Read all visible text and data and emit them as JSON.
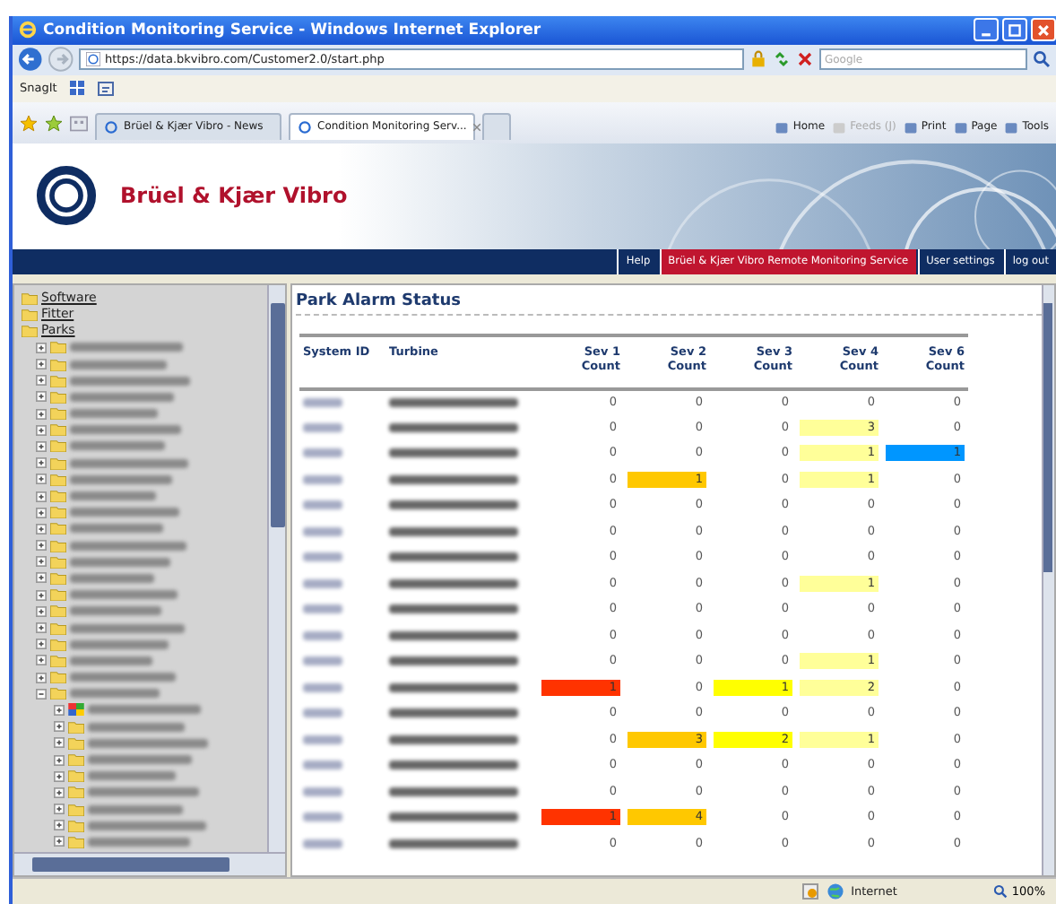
{
  "window": {
    "title": "Condition Monitoring Service - Windows Internet Explorer"
  },
  "address_bar": {
    "url": "https://data.bkvibro.com/Customer2.0/start.php"
  },
  "search": {
    "placeholder": "Google"
  },
  "links_bar": [
    {
      "label": "SnagIt"
    }
  ],
  "tabs": [
    {
      "label": "Brüel & Kjær Vibro - News",
      "selected": false
    },
    {
      "label": "Condition Monitoring Serv...",
      "selected": true
    }
  ],
  "command_bar": [
    {
      "label": "Home",
      "disabled": false
    },
    {
      "label": "Feeds (J)",
      "disabled": true
    },
    {
      "label": "Print",
      "disabled": false
    },
    {
      "label": "Page",
      "disabled": false
    },
    {
      "label": "Tools",
      "disabled": false
    }
  ],
  "header": {
    "brand": "Brüel & Kjær Vibro"
  },
  "nav": [
    {
      "label": "Help",
      "selected": false
    },
    {
      "label": "Brüel & Kjær Vibro Remote Monitoring Service",
      "selected": true
    },
    {
      "label": "User settings",
      "selected": false
    },
    {
      "label": "log out",
      "selected": false
    }
  ],
  "tree": [
    {
      "label": "Software",
      "kind": "folder"
    },
    {
      "label": "Fitter",
      "kind": "folder"
    },
    {
      "label": "Parks",
      "kind": "folder",
      "children": [
        {
          "kind": "folder"
        },
        {
          "kind": "folder"
        },
        {
          "kind": "folder"
        },
        {
          "kind": "folder"
        },
        {
          "kind": "folder"
        },
        {
          "kind": "folder"
        },
        {
          "kind": "folder"
        },
        {
          "kind": "folder"
        },
        {
          "kind": "folder"
        },
        {
          "kind": "folder"
        },
        {
          "kind": "folder"
        },
        {
          "kind": "folder"
        },
        {
          "kind": "folder"
        },
        {
          "kind": "folder"
        },
        {
          "kind": "folder"
        },
        {
          "kind": "folder"
        },
        {
          "kind": "folder"
        },
        {
          "kind": "folder"
        },
        {
          "kind": "folder"
        },
        {
          "kind": "folder"
        },
        {
          "kind": "folder"
        },
        {
          "kind": "folder",
          "children": [
            {
              "kind": "status"
            },
            {
              "kind": "folder"
            },
            {
              "kind": "folder"
            },
            {
              "kind": "folder"
            },
            {
              "kind": "folder"
            },
            {
              "kind": "folder"
            },
            {
              "kind": "folder"
            },
            {
              "kind": "folder"
            },
            {
              "kind": "folder"
            }
          ]
        }
      ]
    }
  ],
  "content": {
    "title": "Park Alarm Status",
    "columns": [
      {
        "label": "System ID"
      },
      {
        "label": "Turbine"
      },
      {
        "label": "Sev 1 Count",
        "color": "#ff3300"
      },
      {
        "label": "Sev 2 Count",
        "color": "#ffc800"
      },
      {
        "label": "Sev 3 Count",
        "color": "#ffff00"
      },
      {
        "label": "Sev 4 Count",
        "color": "#ffff99"
      },
      {
        "label": "Sev 6 Count",
        "color": "#0096ff"
      }
    ],
    "rows": [
      {
        "counts": [
          "0",
          "0",
          "0",
          "0",
          "0"
        ],
        "alerts": [
          false,
          false,
          false,
          false,
          false
        ]
      },
      {
        "counts": [
          "0",
          "0",
          "0",
          "3",
          "0"
        ],
        "alerts": [
          false,
          false,
          false,
          true,
          false
        ]
      },
      {
        "counts": [
          "0",
          "0",
          "0",
          "1",
          "1"
        ],
        "alerts": [
          false,
          false,
          false,
          true,
          true
        ]
      },
      {
        "counts": [
          "0",
          "1",
          "0",
          "1",
          "0"
        ],
        "alerts": [
          false,
          true,
          false,
          true,
          false
        ]
      },
      {
        "counts": [
          "0",
          "0",
          "0",
          "0",
          "0"
        ],
        "alerts": [
          false,
          false,
          false,
          false,
          false
        ]
      },
      {
        "counts": [
          "0",
          "0",
          "0",
          "0",
          "0"
        ],
        "alerts": [
          false,
          false,
          false,
          false,
          false
        ]
      },
      {
        "counts": [
          "0",
          "0",
          "0",
          "0",
          "0"
        ],
        "alerts": [
          false,
          false,
          false,
          false,
          false
        ]
      },
      {
        "counts": [
          "0",
          "0",
          "0",
          "1",
          "0"
        ],
        "alerts": [
          false,
          false,
          false,
          true,
          false
        ]
      },
      {
        "counts": [
          "0",
          "0",
          "0",
          "0",
          "0"
        ],
        "alerts": [
          false,
          false,
          false,
          false,
          false
        ]
      },
      {
        "counts": [
          "0",
          "0",
          "0",
          "0",
          "0"
        ],
        "alerts": [
          false,
          false,
          false,
          false,
          false
        ]
      },
      {
        "counts": [
          "0",
          "0",
          "0",
          "1",
          "0"
        ],
        "alerts": [
          false,
          false,
          false,
          true,
          false
        ]
      },
      {
        "counts": [
          "1",
          "0",
          "1",
          "2",
          "0"
        ],
        "alerts": [
          true,
          false,
          true,
          true,
          false
        ]
      },
      {
        "counts": [
          "0",
          "0",
          "0",
          "0",
          "0"
        ],
        "alerts": [
          false,
          false,
          false,
          false,
          false
        ]
      },
      {
        "counts": [
          "0",
          "3",
          "2",
          "1",
          "0"
        ],
        "alerts": [
          false,
          true,
          true,
          true,
          false
        ]
      },
      {
        "counts": [
          "0",
          "0",
          "0",
          "0",
          "0"
        ],
        "alerts": [
          false,
          false,
          false,
          false,
          false
        ]
      },
      {
        "counts": [
          "0",
          "0",
          "0",
          "0",
          "0"
        ],
        "alerts": [
          false,
          false,
          false,
          false,
          false
        ]
      },
      {
        "counts": [
          "1",
          "4",
          "0",
          "0",
          "0"
        ],
        "alerts": [
          true,
          true,
          false,
          false,
          false
        ]
      },
      {
        "counts": [
          "0",
          "0",
          "0",
          "0",
          "0"
        ],
        "alerts": [
          false,
          false,
          false,
          false,
          false
        ]
      }
    ]
  },
  "status_bar": {
    "zone": "Internet",
    "zoom": "100%"
  }
}
